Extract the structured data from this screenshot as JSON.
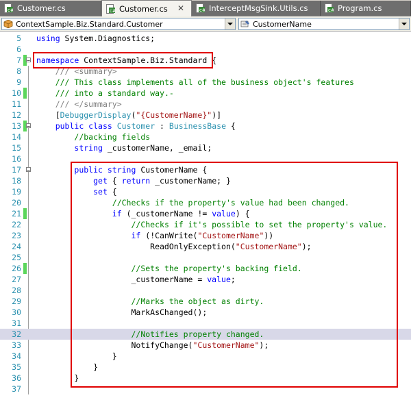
{
  "tabs": [
    {
      "label": "Customer.cs",
      "active": false
    },
    {
      "label": "Customer.cs",
      "active": true
    },
    {
      "label": "InterceptMsgSink.Utils.cs",
      "active": false
    },
    {
      "label": "Program.cs",
      "active": false
    }
  ],
  "nav": {
    "type_selector": "ContextSample.Biz.Standard.Customer",
    "member_selector": "CustomerName"
  },
  "colors": {
    "keyword": "#0000ff",
    "type": "#2b91af",
    "comment": "#008000",
    "string": "#a31515",
    "highlight_box": "#e00000",
    "changed_marker": "#5cd65c"
  },
  "code": [
    {
      "n": "5",
      "tokens": [
        {
          "c": "kw",
          "t": "using"
        },
        {
          "t": " System.Diagnostics;"
        }
      ]
    },
    {
      "n": "6",
      "tokens": []
    },
    {
      "n": "7",
      "tokens": [
        {
          "c": "kw",
          "t": "namespace"
        },
        {
          "t": " ContextSample.Biz.Standard {"
        }
      ]
    },
    {
      "n": "8",
      "tokens": [
        {
          "t": "    "
        },
        {
          "c": "xdoc",
          "t": "/// <summary>"
        }
      ]
    },
    {
      "n": "9",
      "tokens": [
        {
          "t": "    "
        },
        {
          "c": "cm",
          "t": "/// This class implements all of the business object's features"
        }
      ]
    },
    {
      "n": "10",
      "tokens": [
        {
          "t": "    "
        },
        {
          "c": "cm",
          "t": "/// into a standard way.-"
        }
      ]
    },
    {
      "n": "11",
      "tokens": [
        {
          "t": "    "
        },
        {
          "c": "xdoc",
          "t": "/// </summary>"
        }
      ]
    },
    {
      "n": "12",
      "tokens": [
        {
          "t": "    ["
        },
        {
          "c": "ty",
          "t": "DebuggerDisplay"
        },
        {
          "t": "("
        },
        {
          "c": "st",
          "t": "\"{CustomerName}\""
        },
        {
          "t": ")]"
        }
      ]
    },
    {
      "n": "13",
      "tokens": [
        {
          "t": "    "
        },
        {
          "c": "kw",
          "t": "public class"
        },
        {
          "t": " "
        },
        {
          "c": "ty",
          "t": "Customer"
        },
        {
          "t": " : "
        },
        {
          "c": "ty",
          "t": "BusinessBase"
        },
        {
          "t": " {"
        }
      ]
    },
    {
      "n": "14",
      "tokens": [
        {
          "t": "        "
        },
        {
          "c": "cm",
          "t": "//backing fields"
        }
      ]
    },
    {
      "n": "15",
      "tokens": [
        {
          "t": "        "
        },
        {
          "c": "kw",
          "t": "string"
        },
        {
          "t": " _customerName, _email;"
        }
      ]
    },
    {
      "n": "16",
      "tokens": []
    },
    {
      "n": "17",
      "tokens": [
        {
          "t": "        "
        },
        {
          "c": "kw",
          "t": "public string"
        },
        {
          "t": " CustomerName {"
        }
      ]
    },
    {
      "n": "18",
      "tokens": [
        {
          "t": "            "
        },
        {
          "c": "kw",
          "t": "get"
        },
        {
          "t": " { "
        },
        {
          "c": "kw",
          "t": "return"
        },
        {
          "t": " _customerName; }"
        }
      ]
    },
    {
      "n": "19",
      "tokens": [
        {
          "t": "            "
        },
        {
          "c": "kw",
          "t": "set"
        },
        {
          "t": " {"
        }
      ]
    },
    {
      "n": "20",
      "tokens": [
        {
          "t": "                "
        },
        {
          "c": "cm",
          "t": "//Checks if the property's value had been changed."
        }
      ]
    },
    {
      "n": "21",
      "tokens": [
        {
          "t": "                "
        },
        {
          "c": "kw",
          "t": "if"
        },
        {
          "t": " (_customerName != "
        },
        {
          "c": "kw",
          "t": "value"
        },
        {
          "t": ") {"
        }
      ]
    },
    {
      "n": "22",
      "tokens": [
        {
          "t": "                    "
        },
        {
          "c": "cm",
          "t": "//Checks if it's possible to set the property's value."
        }
      ]
    },
    {
      "n": "23",
      "tokens": [
        {
          "t": "                    "
        },
        {
          "c": "kw",
          "t": "if"
        },
        {
          "t": " (!CanWrite("
        },
        {
          "c": "st",
          "t": "\"CustomerName\""
        },
        {
          "t": "))"
        }
      ]
    },
    {
      "n": "24",
      "tokens": [
        {
          "t": "                        ReadOnlyException("
        },
        {
          "c": "st",
          "t": "\"CustomerName\""
        },
        {
          "t": ");"
        }
      ]
    },
    {
      "n": "25",
      "tokens": []
    },
    {
      "n": "26",
      "tokens": [
        {
          "t": "                    "
        },
        {
          "c": "cm",
          "t": "//Sets the property's backing field."
        }
      ]
    },
    {
      "n": "27",
      "tokens": [
        {
          "t": "                    _customerName = "
        },
        {
          "c": "kw",
          "t": "value"
        },
        {
          "t": ";"
        }
      ]
    },
    {
      "n": "28",
      "tokens": []
    },
    {
      "n": "29",
      "tokens": [
        {
          "t": "                    "
        },
        {
          "c": "cm",
          "t": "//Marks the object as dirty."
        }
      ]
    },
    {
      "n": "30",
      "tokens": [
        {
          "t": "                    MarkAsChanged();"
        }
      ]
    },
    {
      "n": "31",
      "tokens": []
    },
    {
      "n": "32",
      "tokens": [
        {
          "t": "                    "
        },
        {
          "c": "cm",
          "t": "//Notifies property changed."
        }
      ]
    },
    {
      "n": "33",
      "tokens": [
        {
          "t": "                    NotifyChange("
        },
        {
          "c": "st",
          "t": "\"CustomerName\""
        },
        {
          "t": ");"
        }
      ]
    },
    {
      "n": "34",
      "tokens": [
        {
          "t": "                }"
        }
      ]
    },
    {
      "n": "35",
      "tokens": [
        {
          "t": "            }"
        }
      ]
    },
    {
      "n": "36",
      "tokens": [
        {
          "t": "        }"
        }
      ]
    },
    {
      "n": "37",
      "tokens": []
    }
  ]
}
